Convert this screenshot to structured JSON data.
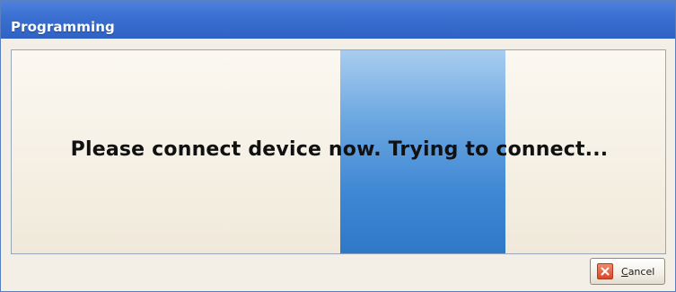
{
  "window": {
    "title": "Programming"
  },
  "dialog": {
    "message": "Please connect device now. Trying to connect..."
  },
  "footer": {
    "cancel_label": "Cancel",
    "cancel_accel_char": "C",
    "cancel_rest": "ancel",
    "cancel_icon": "close-icon"
  },
  "colors": {
    "titlebar": "#3a6fd0",
    "progress_block": "#3e87d4",
    "panel_background": "#f6f1e6",
    "cancel_icon": "#d8482a"
  }
}
